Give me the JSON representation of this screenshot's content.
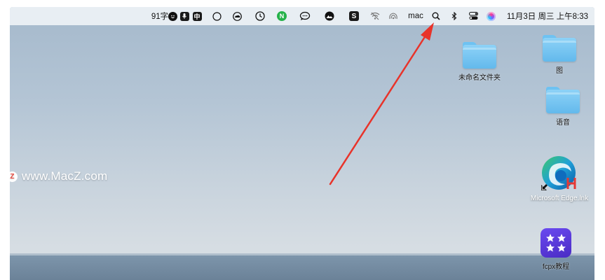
{
  "menubar": {
    "word_count": "91字",
    "ime_label": "中",
    "wifi_text": "mac",
    "datetime": "11月3日 周三 上午8:33",
    "icons": [
      "emoji-face-icon",
      "microphone-icon",
      "input-method-icon",
      "circle-icon",
      "creative-cloud-icon",
      "clock-icon",
      "n-app-icon",
      "chat-icon",
      "mountain-icon",
      "s-app-icon",
      "wifi-off-icon",
      "airdrop-icon",
      "spotlight-search-icon",
      "bluetooth-icon",
      "control-center-icon",
      "siri-icon"
    ]
  },
  "desktop": {
    "items": [
      {
        "label": "未命名文件夹",
        "icon": "folder-icon"
      },
      {
        "label": "图",
        "icon": "folder-icon"
      },
      {
        "label": "语音",
        "icon": "folder-icon"
      },
      {
        "label": "Microsoft Edge.lnk",
        "icon": "edge-icon"
      },
      {
        "label": "fcpx教程",
        "icon": "stars-app-icon"
      }
    ]
  },
  "watermark": {
    "text": "www.MacZ.com",
    "logo": "Z"
  },
  "colors": {
    "arrow": "#e8332a",
    "folder": "#6ec2f2",
    "fcpx_tile": "#5a3ad6"
  }
}
